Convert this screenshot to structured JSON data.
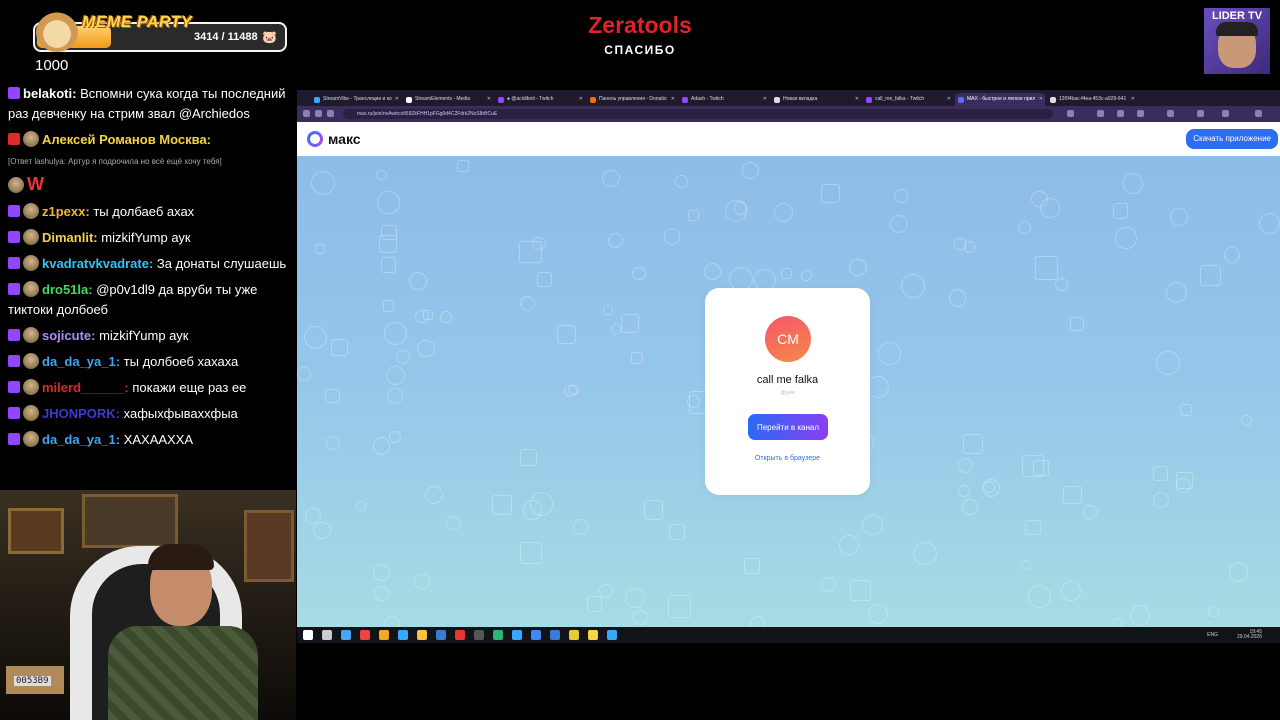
{
  "overlay": {
    "meme_title": "MEME PARTY",
    "meme_count": "3414 / 11488",
    "meme_progress": 0.297,
    "meme_sub": "1000",
    "brand_title": "Zeratools",
    "brand_sub": "СПАСИБО",
    "lider_label": "LIDER TV"
  },
  "chat": [
    {
      "badges": [
        "tw"
      ],
      "nick": "belakoti:",
      "nick_color": "#ffffff",
      "text": "Вспомни сука когда ты последний раз девченку на стрим звал @Archiedos"
    },
    {
      "badges": [
        "live",
        "dot"
      ],
      "nick": "Алексей Романов Москва:",
      "nick_color": "#f4d33f",
      "text": ""
    },
    {
      "reply": "[Ответ lashulya: Артур я подрочила но всё ещё хочу тебя]"
    },
    {
      "badges": [
        "dot"
      ],
      "nick": "",
      "nick_color": "#ffffff",
      "text": "W",
      "text_color": "#e8353f"
    },
    {
      "badges": [
        "tw",
        "dot"
      ],
      "nick": "z1pexx:",
      "nick_color": "#f4b62d",
      "text": "ты долбаеб ахах"
    },
    {
      "badges": [
        "tw",
        "dot"
      ],
      "nick": "Dimanlit:",
      "nick_color": "#f4d33f",
      "text": "mizkifYump аук"
    },
    {
      "badges": [
        "tw",
        "dot"
      ],
      "nick": "kvadratvkvadrate:",
      "nick_color": "#33c4f2",
      "text": "За донаты слушаешь"
    },
    {
      "badges": [
        "tw",
        "dot"
      ],
      "nick": "dro51la:",
      "nick_color": "#3cdc60",
      "text": "@p0v1dl9 да вруби ты уже тиктоки долбоеб"
    },
    {
      "badges": [
        "tw",
        "dot"
      ],
      "nick": "sojicute:",
      "nick_color": "#b08cf2",
      "text": "mizkifYump аук"
    },
    {
      "badges": [
        "tw",
        "dot"
      ],
      "nick": "da_da_ya_1:",
      "nick_color": "#3aa8f2",
      "text": "ты долбоеб хахаха"
    },
    {
      "badges": [
        "tw",
        "dot"
      ],
      "nick": "milerd______:",
      "nick_color": "#d42a2a",
      "text": "покажи еще раз ее"
    },
    {
      "badges": [
        "tw",
        "dot"
      ],
      "nick": "JHONPORK:",
      "nick_color": "#3a3ad4",
      "text": "хафыхфываххфыа"
    },
    {
      "badges": [
        "tw",
        "dot"
      ],
      "nick": "da_da_ya_1:",
      "nick_color": "#3aa8f2",
      "text": "ХАХААХХА"
    }
  ],
  "webcam": {
    "box_label": "005ЗВ9"
  },
  "browser": {
    "tabs": [
      {
        "label": "StreamVibe - Трансляции и ко",
        "fav": "#33aaff"
      },
      {
        "label": "StreamElements - Media",
        "fav": "#ffffff"
      },
      {
        "label": "● @acidiboti - Twitch",
        "fav": "#9146ff"
      },
      {
        "label": "Панель управления - Donatio",
        "fav": "#ff6a00"
      },
      {
        "label": "Adash - Twitch",
        "fav": "#9146ff"
      },
      {
        "label": "Новая вкладка",
        "fav": "#dddddd"
      },
      {
        "label": "call_me_falka - Twitch",
        "fav": "#9146ff"
      },
      {
        "label": "MAX - быстрое и легкое прил",
        "fav": "#5b6ef5"
      },
      {
        "label": "120f4bac-f4ea-453c-a929-641",
        "fav": "#dddddd"
      }
    ],
    "url": "max.ru/join/nxAwtrcsIt59ZkFHH1pFGg0d4C2Fdrk2NoS8rBCuE"
  },
  "max_page": {
    "brand": "макс",
    "download_label": "Скачать приложение",
    "avatar_initials": "CM",
    "channel_name": "call me falka",
    "channel_handle": "@yeie",
    "primary_button": "Перейти в канал",
    "secondary_link": "Открыть в браузере"
  },
  "taskbar": {
    "lang": "ENG",
    "time": "19:45",
    "date": "29.04.2026"
  },
  "colors": {
    "accent": "#2d6cf4",
    "twitch": "#9146ff",
    "brand_red": "#e2222a"
  }
}
